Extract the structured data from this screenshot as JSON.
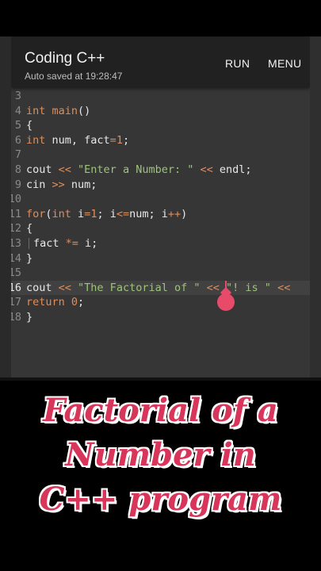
{
  "app": {
    "title": "Coding C++",
    "subtitle": "Auto saved at 19:28:47",
    "run_label": "RUN",
    "menu_label": "MENU"
  },
  "editor": {
    "current_line": 16,
    "lines": [
      {
        "n": "3",
        "tokens": []
      },
      {
        "n": "4",
        "tokens": [
          [
            "kw",
            "int "
          ],
          [
            "kw",
            "main"
          ],
          [
            "plain",
            "()"
          ]
        ]
      },
      {
        "n": "5",
        "tokens": [
          [
            "plain",
            "{"
          ]
        ]
      },
      {
        "n": "6",
        "tokens": [
          [
            "kw",
            "int "
          ],
          [
            "plain",
            "num, fact"
          ],
          [
            "op",
            "="
          ],
          [
            "num",
            "1"
          ],
          [
            "plain",
            ";"
          ]
        ]
      },
      {
        "n": "7",
        "tokens": []
      },
      {
        "n": "8",
        "tokens": [
          [
            "plain",
            "cout "
          ],
          [
            "op",
            "<<"
          ],
          [
            "plain",
            " "
          ],
          [
            "str",
            "\"Enter a Number: \""
          ],
          [
            "plain",
            " "
          ],
          [
            "op",
            "<<"
          ],
          [
            "plain",
            " endl;"
          ]
        ]
      },
      {
        "n": "9",
        "tokens": [
          [
            "plain",
            "cin "
          ],
          [
            "op",
            ">>"
          ],
          [
            "plain",
            " num;"
          ]
        ]
      },
      {
        "n": "10",
        "tokens": []
      },
      {
        "n": "11",
        "tokens": [
          [
            "kw",
            "for"
          ],
          [
            "plain",
            "("
          ],
          [
            "kw",
            "int "
          ],
          [
            "plain",
            "i"
          ],
          [
            "op",
            "="
          ],
          [
            "num",
            "1"
          ],
          [
            "plain",
            "; i"
          ],
          [
            "op",
            "<="
          ],
          [
            "plain",
            "num; i"
          ],
          [
            "op",
            "++"
          ],
          [
            "plain",
            ")"
          ]
        ]
      },
      {
        "n": "12",
        "tokens": [
          [
            "plain",
            "{"
          ]
        ]
      },
      {
        "n": "13",
        "guide": true,
        "tokens": [
          [
            "plain",
            "fact "
          ],
          [
            "op",
            "*="
          ],
          [
            "plain",
            " i;"
          ]
        ]
      },
      {
        "n": "14",
        "tokens": [
          [
            "plain",
            "}"
          ]
        ]
      },
      {
        "n": "15",
        "tokens": []
      },
      {
        "n": "16",
        "tokens": [
          [
            "plain",
            "cout "
          ],
          [
            "op",
            "<<"
          ],
          [
            "plain",
            " "
          ],
          [
            "str",
            "\"The Factorial of \""
          ],
          [
            "plain",
            " "
          ],
          [
            "op",
            "<<"
          ],
          [
            "plain",
            " "
          ],
          [
            "str",
            "\"! is \""
          ],
          [
            "plain",
            " "
          ],
          [
            "op",
            "<<"
          ]
        ]
      },
      {
        "n": "17",
        "tokens": [
          [
            "kw",
            "return "
          ],
          [
            "num",
            "0"
          ],
          [
            "plain",
            ";"
          ]
        ]
      },
      {
        "n": "18",
        "tokens": [
          [
            "plain",
            "}"
          ]
        ]
      }
    ]
  },
  "caption": {
    "line1": "Factorial of a",
    "line2": "Number in",
    "line3": "C++ program"
  },
  "colors": {
    "keyword": "#e08c5a",
    "string": "#9ec37a",
    "cursor": "#e84a6a",
    "caption": "#d8355a"
  }
}
